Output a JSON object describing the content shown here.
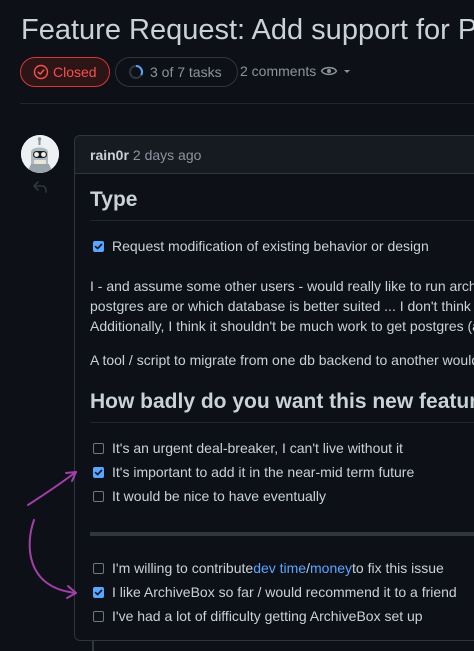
{
  "issue": {
    "title": "Feature Request: Add support for P",
    "state": "Closed",
    "tasks": "3 of 7 tasks",
    "comments": "2 comments"
  },
  "comment": {
    "author": "rain0r",
    "time": "2 days ago",
    "type_heading": "Type",
    "type_task": "Request modification of existing behavior or design",
    "para1_line1": "I - and assume some other users - would really like to run archiv",
    "para1_line2": "postgres are or which database is better suited ... I don't think t",
    "para1_line3": "Additionally, I think it shouldn't be much work to get postgres (a",
    "para2": "A tool / script to migrate from one db backend to another would",
    "badly_heading": "How badly do you want this new feature?",
    "urgency_tasks": [
      {
        "label": "It's an urgent deal-breaker, I can't live without it",
        "checked": false
      },
      {
        "label": "It's important to add it in the near-mid term future",
        "checked": true
      },
      {
        "label": "It would be nice to have eventually",
        "checked": false
      }
    ],
    "contribute": {
      "before": "I'm willing to contribute ",
      "link1": "dev time",
      "sep": " / ",
      "link2": "money",
      "after": " to fix this issue"
    },
    "final_tasks": [
      {
        "label": "I like ArchiveBox so far / would recommend it to a friend",
        "checked": true
      },
      {
        "label": "I've had a lot of difficulty getting ArchiveBox set up",
        "checked": false
      }
    ]
  },
  "colors": {
    "background": "#0d1117",
    "closed": "#f85149",
    "link": "#58a6ff",
    "checkbox_checked": "#58a6ff",
    "annotation_arrow": "#a33fa8"
  }
}
